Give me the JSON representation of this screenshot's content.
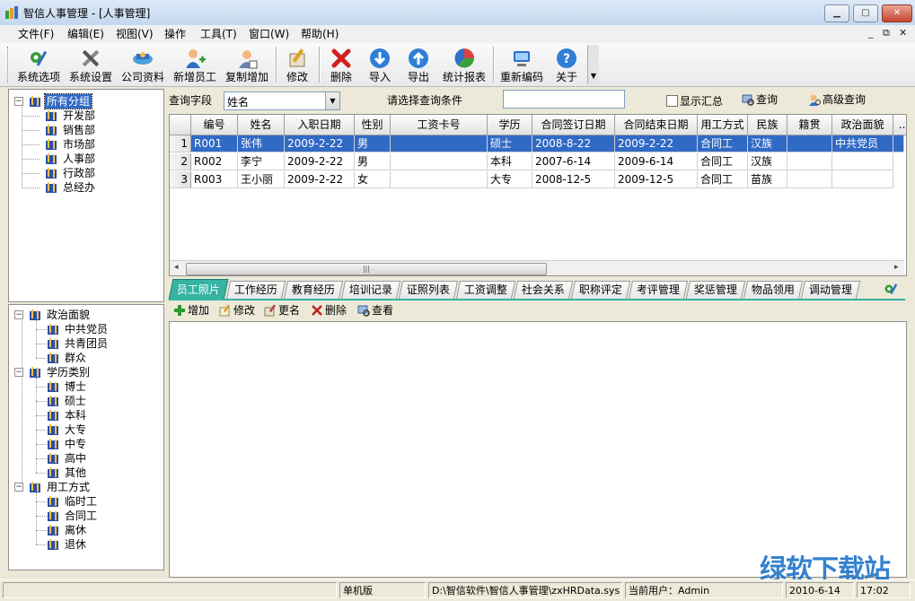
{
  "window": {
    "title": "智信人事管理 - [人事管理]",
    "controls": [
      "minimize-icon",
      "maximize-icon",
      "close-icon"
    ]
  },
  "menu": [
    "文件(F)",
    "编辑(E)",
    "视图(V)",
    "操作",
    "工具(T)",
    "窗口(W)",
    "帮助(H)"
  ],
  "toolbar": {
    "buttons": [
      {
        "label": "系统选项",
        "icon": "system-options-icon"
      },
      {
        "label": "系统设置",
        "icon": "tools-icon"
      },
      {
        "label": "公司资料",
        "icon": "company-icon"
      },
      {
        "label": "新增员工",
        "icon": "add-user-icon"
      },
      {
        "label": "复制增加",
        "icon": "copy-add-icon"
      },
      {
        "label": "修改",
        "icon": "edit-icon"
      },
      {
        "label": "删除",
        "icon": "delete-icon"
      },
      {
        "label": "导入",
        "icon": "import-icon"
      },
      {
        "label": "导出",
        "icon": "export-icon"
      },
      {
        "label": "统计报表",
        "icon": "report-icon"
      },
      {
        "label": "重新编码",
        "icon": "recode-icon"
      },
      {
        "label": "关于",
        "icon": "about-icon"
      }
    ]
  },
  "tree_top": {
    "root": "所有分组",
    "children": [
      "开发部",
      "销售部",
      "市场部",
      "人事部",
      "行政部",
      "总经办"
    ]
  },
  "tree_bottom": {
    "groups": [
      {
        "label": "政治面貌",
        "children": [
          "中共党员",
          "共青团员",
          "群众"
        ]
      },
      {
        "label": "学历类别",
        "children": [
          "博士",
          "硕士",
          "本科",
          "大专",
          "中专",
          "高中",
          "其他"
        ]
      },
      {
        "label": "用工方式",
        "children": [
          "临时工",
          "合同工",
          "离休",
          "退休"
        ]
      }
    ]
  },
  "query": {
    "field_label": "查询字段",
    "field_value": "姓名",
    "condition_label": "请选择查询条件",
    "condition_value": "",
    "show_summary_label": "显示汇总",
    "show_summary_checked": false,
    "query_button": "查询",
    "advanced_button": "高级查询"
  },
  "grid": {
    "columns": [
      "编号",
      "姓名",
      "入职日期",
      "性别",
      "工资卡号",
      "学历",
      "合同签订日期",
      "合同结束日期",
      "用工方式",
      "民族",
      "籍贯",
      "政治面貌",
      "..."
    ],
    "rows": [
      {
        "rn": "1",
        "cells": [
          "R001",
          "张伟",
          "2009-2-22",
          "男",
          "",
          "硕士",
          "2008-8-22",
          "2009-2-22",
          "合同工",
          "汉族",
          "",
          "中共党员"
        ]
      },
      {
        "rn": "2",
        "cells": [
          "R002",
          "李宁",
          "2009-2-22",
          "男",
          "",
          "本科",
          "2007-6-14",
          "2009-6-14",
          "合同工",
          "汉族",
          "",
          ""
        ]
      },
      {
        "rn": "3",
        "cells": [
          "R003",
          "王小丽",
          "2009-2-22",
          "女",
          "",
          "大专",
          "2008-12-5",
          "2009-12-5",
          "合同工",
          "苗族",
          "",
          ""
        ]
      }
    ],
    "selected_row": 0
  },
  "tabs": [
    "员工照片",
    "工作经历",
    "教育经历",
    "培训记录",
    "证照列表",
    "工资调整",
    "社会关系",
    "职称评定",
    "考评管理",
    "奖惩管理",
    "物品领用",
    "调动管理"
  ],
  "active_tab": 0,
  "subtoolbar": [
    "增加",
    "修改",
    "更名",
    "删除",
    "查看"
  ],
  "status": {
    "mode": "单机版",
    "path": "D:\\智信软件\\智信人事管理\\zxHRData.sys",
    "user": "当前用户：Admin",
    "date": "2010-6-14",
    "time": "17:02"
  },
  "watermark": "绿软下载站",
  "colors": {
    "accent_tab": "#36b3a2",
    "selection": "#316ac5",
    "watermark": "#1d75c9"
  }
}
